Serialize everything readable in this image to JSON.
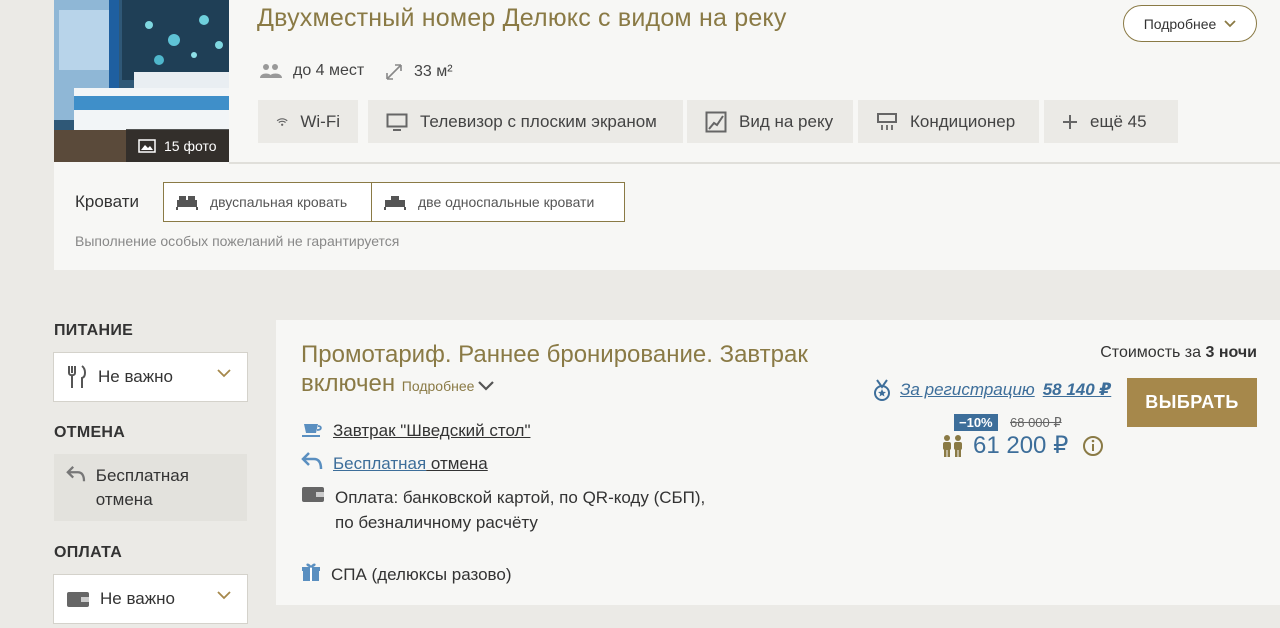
{
  "room": {
    "title": "Двухместный номер Делюкс с видом на реку",
    "photo_count": "15 фото",
    "more_label": "Подробнее",
    "guests": "до 4 мест",
    "area": "33 м²",
    "amenities": [
      "Wi-Fi",
      "Телевизор с плоским экраном",
      "Вид на реку",
      "Кондиционер",
      "ещё 45"
    ],
    "beds_label": "Кровати",
    "beds": [
      "двуспальная кровать",
      "две односпальные кровати"
    ],
    "wish_note": "Выполнение особых пожеланий не гарантируется"
  },
  "filters": {
    "food": {
      "heading": "ПИТАНИЕ",
      "value": "Не важно"
    },
    "cancel": {
      "heading": "ОТМЕНА",
      "value": "Бесплатная отмена"
    },
    "payment": {
      "heading": "ОПЛАТА",
      "value": "Не важно"
    }
  },
  "rate": {
    "title": "Промотариф. Раннее бронирование. Завтрак включен",
    "more_label": "Подробнее",
    "breakfast": "Завтрак \"Шведский стол\"",
    "cancel_link": "Бесплатная",
    "cancel_rest": " отмена",
    "payment_line1": "Оплата: банковской картой, по QR-коду (СБП),",
    "payment_line2": "по безналичному расчёту",
    "spa": "СПА (делюксы разово)",
    "price_header_prefix": "Стоимость за ",
    "price_header_nights": "3 ночи",
    "reg_label": "За регистрацию",
    "reg_amount": "58 140 ₽",
    "discount": "−10%",
    "old_price": "68 000 ₽",
    "new_price": "61 200 ₽",
    "choose_label": "ВЫБРАТЬ"
  },
  "colors": {
    "accent_gold": "#8a7a45",
    "button_gold": "#a6884b",
    "link_blue": "#3d6e9a"
  }
}
